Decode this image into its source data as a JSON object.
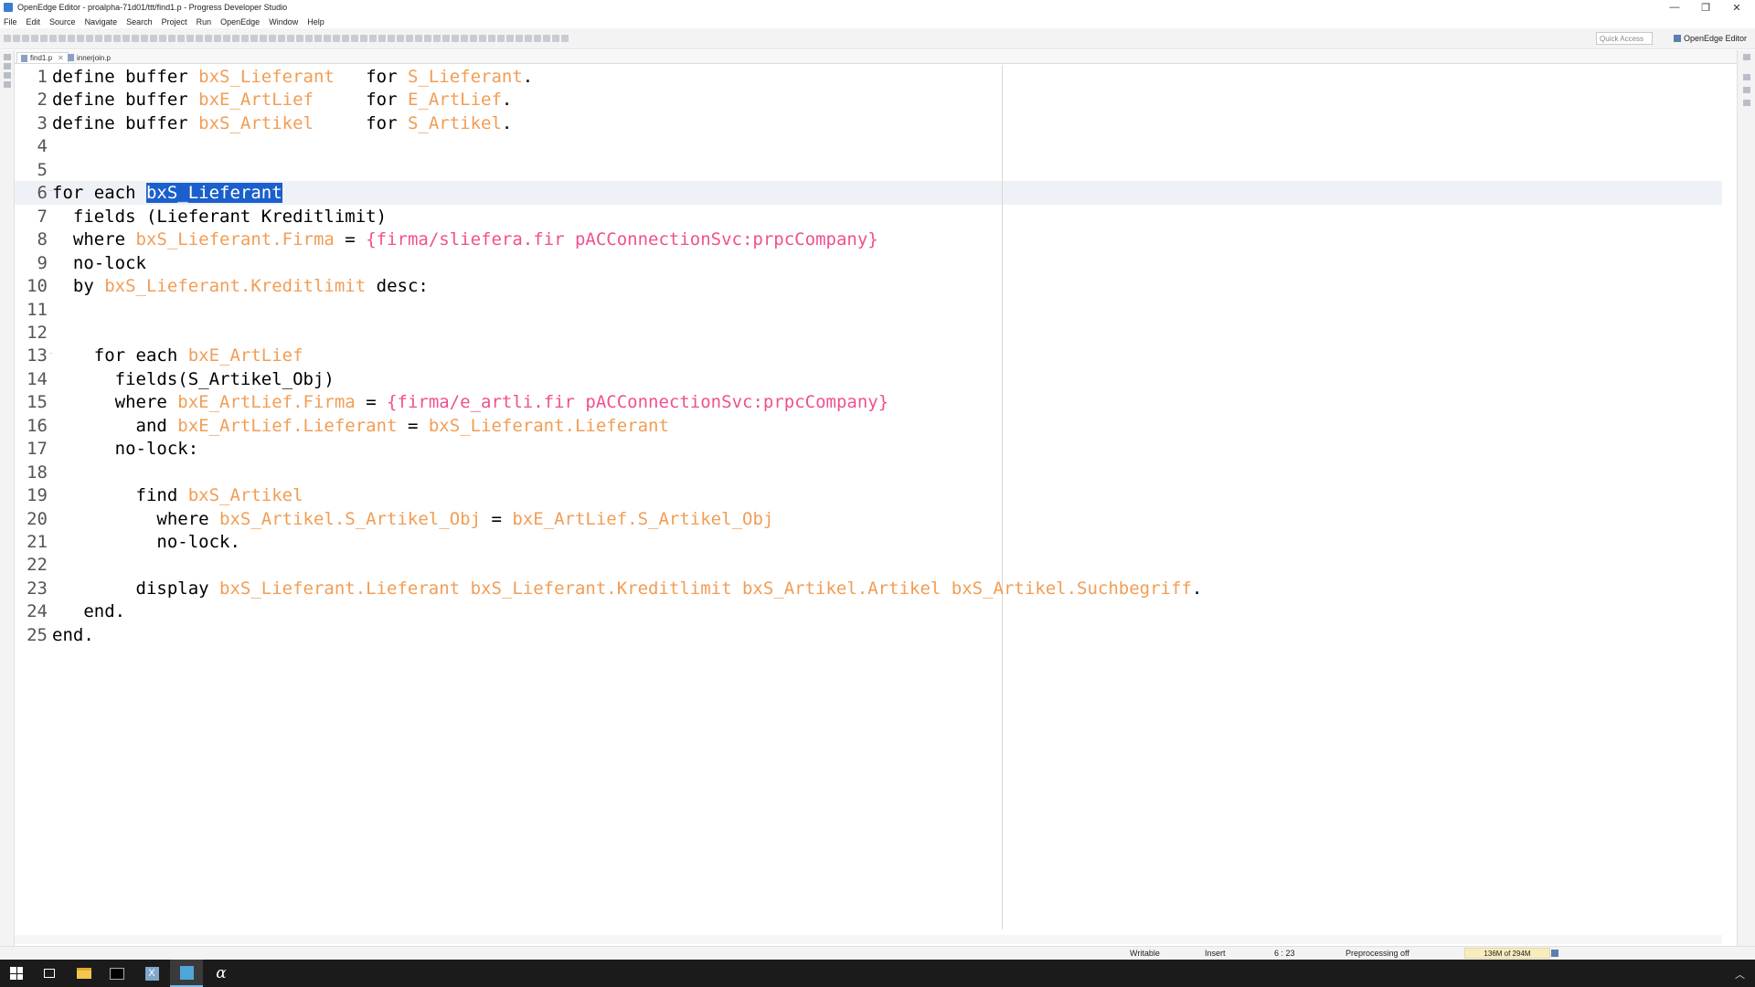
{
  "window": {
    "title": "OpenEdge Editor - proalpha-71d01/ttt/find1.p - Progress Developer Studio",
    "minimize": "—",
    "restore": "❐",
    "close": "✕"
  },
  "menu": [
    "File",
    "Edit",
    "Source",
    "Navigate",
    "Search",
    "Project",
    "Run",
    "OpenEdge",
    "Window",
    "Help"
  ],
  "toolbar": {
    "quick_access_placeholder": "Quick Access",
    "perspective_label": "OpenEdge Editor"
  },
  "tabs": [
    {
      "label": "find1.p",
      "close": "✕",
      "active": true
    },
    {
      "label": "innerjoin.p",
      "active": false
    }
  ],
  "editor": {
    "lines": [
      {
        "n": "1",
        "tokens": [
          {
            "t": "define buffer ",
            "k": "kw"
          },
          {
            "t": "bxS_Lieferant",
            "k": "id"
          },
          {
            "t": "   for ",
            "k": "kw"
          },
          {
            "t": "S_Lieferant",
            "k": "id"
          },
          {
            "t": ".",
            "k": "kw"
          }
        ]
      },
      {
        "n": "2",
        "tokens": [
          {
            "t": "define buffer ",
            "k": "kw"
          },
          {
            "t": "bxE_ArtLief",
            "k": "id"
          },
          {
            "t": "     for ",
            "k": "kw"
          },
          {
            "t": "E_ArtLief",
            "k": "id"
          },
          {
            "t": ".",
            "k": "kw"
          }
        ]
      },
      {
        "n": "3",
        "tokens": [
          {
            "t": "define buffer ",
            "k": "kw"
          },
          {
            "t": "bxS_Artikel",
            "k": "id"
          },
          {
            "t": "     for ",
            "k": "kw"
          },
          {
            "t": "S_Artikel",
            "k": "id"
          },
          {
            "t": ".",
            "k": "kw"
          }
        ]
      },
      {
        "n": "4",
        "tokens": []
      },
      {
        "n": "5",
        "tokens": []
      },
      {
        "n": "6",
        "fold": "⁻",
        "tokens": [
          {
            "t": "for each ",
            "k": "kw"
          },
          {
            "t": "bxS_Lieferant",
            "k": "sel"
          }
        ]
      },
      {
        "n": "7",
        "tokens": [
          {
            "t": "  fields (Lieferant Kreditlimit)",
            "k": "kw"
          }
        ]
      },
      {
        "n": "8",
        "tokens": [
          {
            "t": "  where ",
            "k": "kw"
          },
          {
            "t": "bxS_Lieferant.Firma",
            "k": "id"
          },
          {
            "t": " = ",
            "k": "kw"
          },
          {
            "t": "{firma/sliefera.fir pACConnectionSvc:prpcCompany}",
            "k": "pp"
          }
        ]
      },
      {
        "n": "9",
        "tokens": [
          {
            "t": "  no-lock",
            "k": "kw"
          }
        ]
      },
      {
        "n": "10",
        "tokens": [
          {
            "t": "  by ",
            "k": "kw"
          },
          {
            "t": "bxS_Lieferant.Kreditlimit",
            "k": "id"
          },
          {
            "t": " desc:",
            "k": "kw"
          }
        ]
      },
      {
        "n": "11",
        "tokens": []
      },
      {
        "n": "12",
        "tokens": []
      },
      {
        "n": "13",
        "fold": "⁻",
        "tokens": [
          {
            "t": "    for each ",
            "k": "kw"
          },
          {
            "t": "bxE_ArtLief",
            "k": "id"
          }
        ]
      },
      {
        "n": "14",
        "tokens": [
          {
            "t": "      fields(S_Artikel_Obj)",
            "k": "kw"
          }
        ]
      },
      {
        "n": "15",
        "tokens": [
          {
            "t": "      where ",
            "k": "kw"
          },
          {
            "t": "bxE_ArtLief.Firma",
            "k": "id"
          },
          {
            "t": " = ",
            "k": "kw"
          },
          {
            "t": "{firma/e_artli.fir pACConnectionSvc:prpcCompany}",
            "k": "pp"
          }
        ]
      },
      {
        "n": "16",
        "tokens": [
          {
            "t": "        and ",
            "k": "kw"
          },
          {
            "t": "bxE_ArtLief.Lieferant",
            "k": "id"
          },
          {
            "t": " = ",
            "k": "kw"
          },
          {
            "t": "bxS_Lieferant.Lieferant",
            "k": "id"
          }
        ]
      },
      {
        "n": "17",
        "tokens": [
          {
            "t": "      no-lock:",
            "k": "kw"
          }
        ]
      },
      {
        "n": "18",
        "tokens": []
      },
      {
        "n": "19",
        "tokens": [
          {
            "t": "        find ",
            "k": "kw"
          },
          {
            "t": "bxS_Artikel",
            "k": "id"
          }
        ]
      },
      {
        "n": "20",
        "tokens": [
          {
            "t": "          where ",
            "k": "kw"
          },
          {
            "t": "bxS_Artikel.S_Artikel_Obj",
            "k": "id"
          },
          {
            "t": " = ",
            "k": "kw"
          },
          {
            "t": "bxE_ArtLief.S_Artikel_Obj",
            "k": "id"
          }
        ]
      },
      {
        "n": "21",
        "tokens": [
          {
            "t": "          no-lock.",
            "k": "kw"
          }
        ]
      },
      {
        "n": "22",
        "tokens": []
      },
      {
        "n": "23",
        "tokens": [
          {
            "t": "        display ",
            "k": "kw"
          },
          {
            "t": "bxS_Lieferant.Lieferant bxS_Lieferant.Kreditlimit bxS_Artikel.Artikel bxS_Artikel.Suchbegriff",
            "k": "id"
          },
          {
            "t": ".",
            "k": "kw"
          }
        ]
      },
      {
        "n": "24",
        "tokens": [
          {
            "t": "   end.",
            "k": "kw"
          }
        ]
      },
      {
        "n": "25",
        "tokens": [
          {
            "t": "end.",
            "k": "kw"
          }
        ]
      }
    ]
  },
  "status": {
    "writable": "Writable",
    "insert_mode": "Insert",
    "cursor_position": "6 : 23",
    "preprocessing": "Preprocessing off",
    "heap": "136M of 294M"
  },
  "colors": {
    "identifier": "#f29d55",
    "preprocessor": "#f0508f",
    "selection": "#1b5fcc",
    "current_line": "#eef1f6"
  },
  "taskbar": {
    "icons": [
      "windows-start-icon",
      "task-view-icon",
      "file-explorer-icon",
      "terminal-icon",
      "excel-icon",
      "developer-studio-icon",
      "proalpha-icon"
    ]
  }
}
